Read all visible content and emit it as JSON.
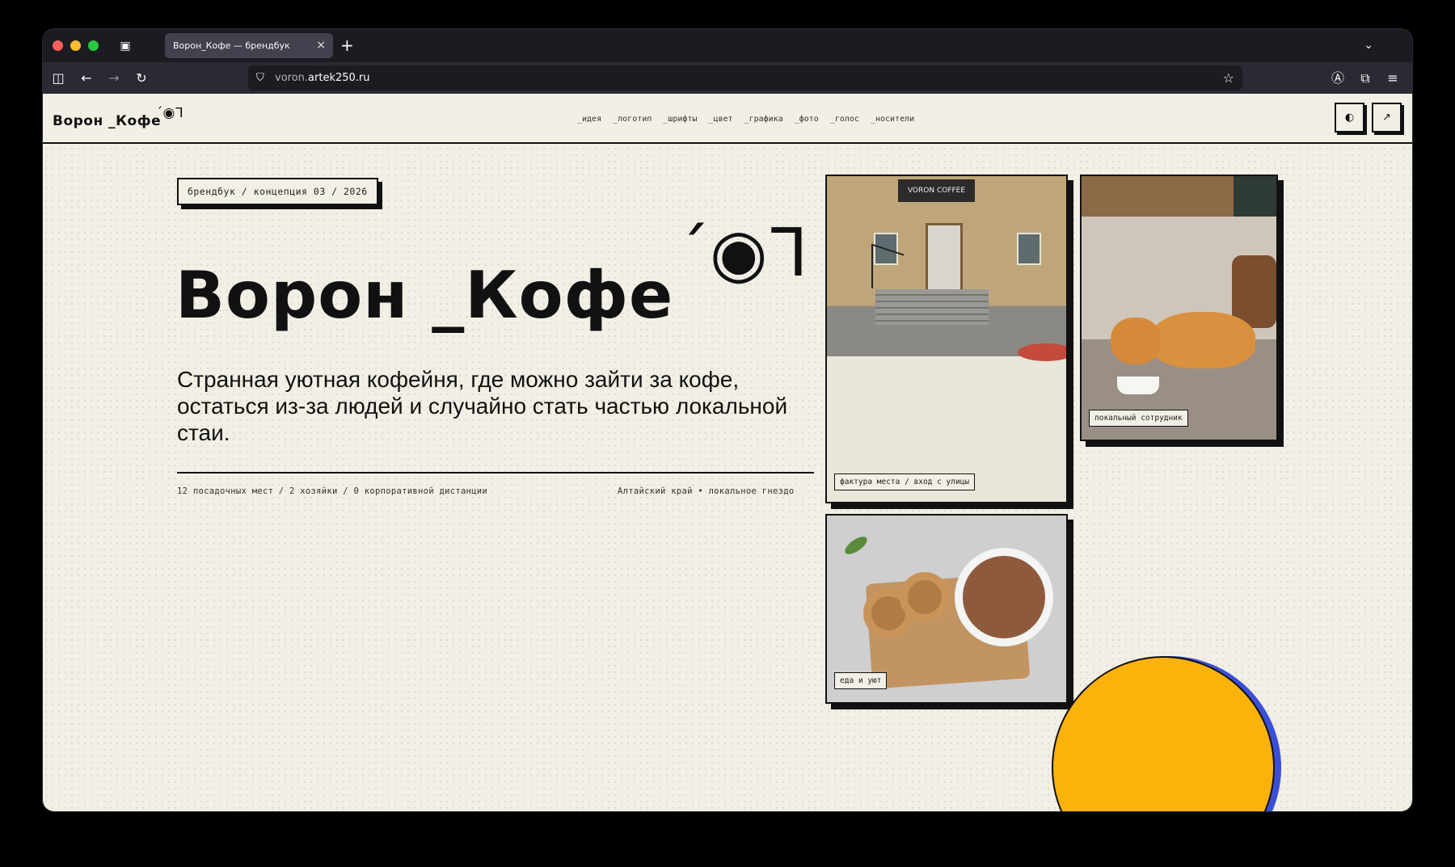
{
  "browser": {
    "tab_title": "Ворон_Кофе — брендбук",
    "tab_close": "×",
    "new_tab": "+",
    "url_prefix": "voron.",
    "url_domain": "artek250.ru"
  },
  "site": {
    "logo": "Ворон _Кофе",
    "logo_mark": "´◉ᒣ",
    "menu": [
      "_идея",
      "_логотип",
      "_шрифты",
      "_цвет",
      "_графика",
      "_фото",
      "_голос",
      "_носители"
    ],
    "theme_button": "◐",
    "external_button": "↗"
  },
  "hero": {
    "tagline": "брендбук / концепция 03 / 2026",
    "title": "Ворон _Кофе",
    "mark": "´◉ᒣ",
    "description": "Странная уютная кофейня, где можно зайти за кофе, остаться из-за людей и случайно стать частью локальной стаи.",
    "meta_left": "12 посадочных мест / 2 хозяйки / 0 корпоративной дистанции",
    "meta_right": "Алтайский край • локальное гнездо"
  },
  "cards": {
    "entrance_caption": "фактура места / вход с улицы",
    "entrance_sign": "VORON COFFEE",
    "cat_caption": "локальный сотрудник",
    "food_caption": "еда и уют"
  },
  "colors": {
    "page_bg": "#f2efe6",
    "ink": "#111111",
    "accent_yellow": "#fbb20b",
    "accent_blue": "#3b4fd6"
  }
}
